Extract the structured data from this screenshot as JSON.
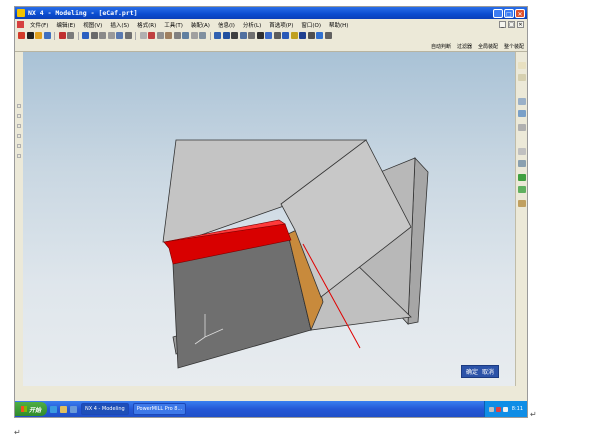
{
  "window": {
    "title": "NX 4 - Modeling - [eCaf.prt]",
    "controls": [
      "_",
      "□",
      "✕"
    ]
  },
  "menubar": {
    "items": [
      "文件(F)",
      "编辑(E)",
      "视图(V)",
      "插入(S)",
      "格式(R)",
      "工具(T)",
      "装配(A)",
      "信息(I)",
      "分析(L)",
      "首选项(P)",
      "窗口(O)",
      "帮助(H)"
    ],
    "window_controls": [
      "_",
      "□",
      "✕"
    ]
  },
  "toolbar2": {
    "items": [
      "自动判断",
      "过滤器",
      "全局装配",
      "整个装配"
    ]
  },
  "viewport": {
    "ok_label": "确定",
    "cancel_label": "取消",
    "colors": {
      "body_top": "#c4c4c4",
      "body_side": "#6f6f6f",
      "red_slot": "#e00000",
      "orange_face": "#c88a3c"
    }
  },
  "taskbar": {
    "start_label": "开始",
    "tasks": [
      "NX 4 - Modeling",
      "PowerMILL Pro 8..."
    ],
    "clock": "8:11"
  },
  "page": {
    "para_marks": [
      "↵",
      "↵"
    ]
  }
}
